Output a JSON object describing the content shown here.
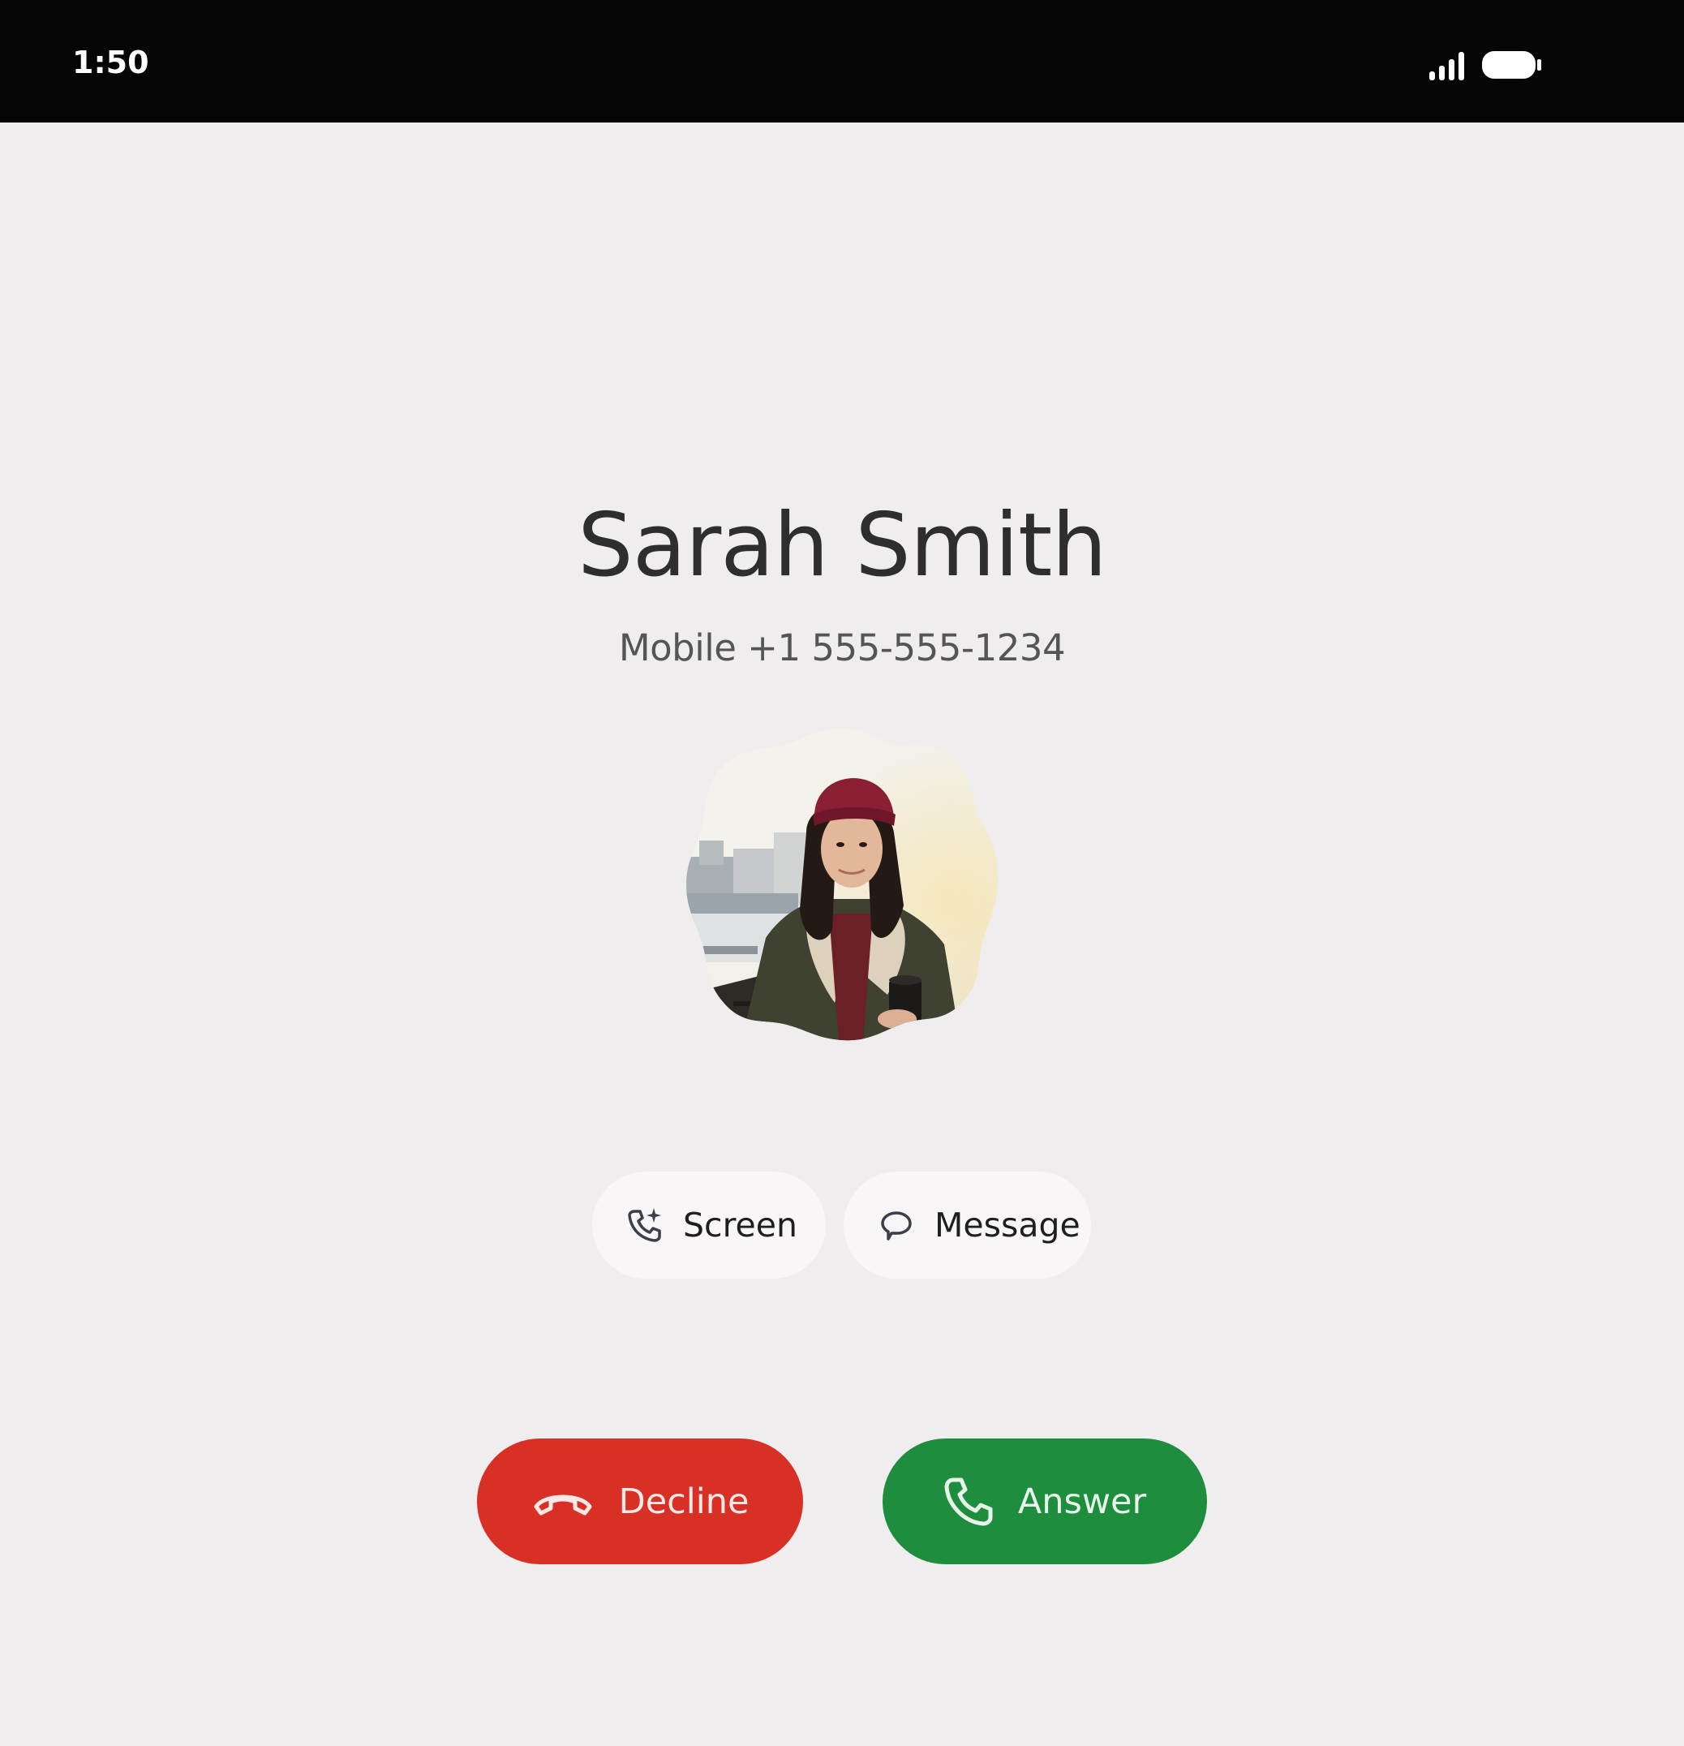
{
  "status_bar": {
    "time": "1:50",
    "signal_icon": "signal-icon",
    "battery_icon": "battery-icon"
  },
  "caller": {
    "name": "Sarah Smith",
    "number": "Mobile +1 555-555-1234",
    "avatar_icon": "contact-photo"
  },
  "actions": {
    "screen_label": "Screen",
    "screen_icon": "call-screen-sparkle-icon",
    "message_label": "Message",
    "message_icon": "speech-bubble-icon"
  },
  "call_buttons": {
    "decline_label": "Decline",
    "decline_icon": "hang-up-icon",
    "decline_color": "#d93025",
    "answer_label": "Answer",
    "answer_icon": "phone-icon",
    "answer_color": "#1e8e3e"
  },
  "colors": {
    "background": "#efeded",
    "status_bar": "#050505",
    "chip_background": "#f8f6f6"
  }
}
